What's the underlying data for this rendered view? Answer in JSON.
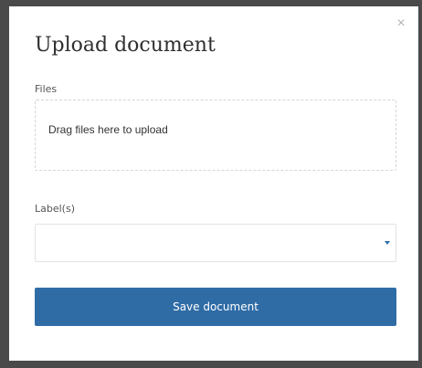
{
  "dialog": {
    "title": "Upload document",
    "close_glyph": "×",
    "close_icon": "close-icon"
  },
  "files": {
    "label": "Files",
    "dropzone_text": "Drag files here to upload"
  },
  "labels": {
    "label": "Label(s)",
    "selected_value": "",
    "dropdown_icon": "caret-down-icon"
  },
  "actions": {
    "save_label": "Save document"
  },
  "colors": {
    "primary": "#2f6ca6",
    "backdrop": "#4a4a4a"
  }
}
